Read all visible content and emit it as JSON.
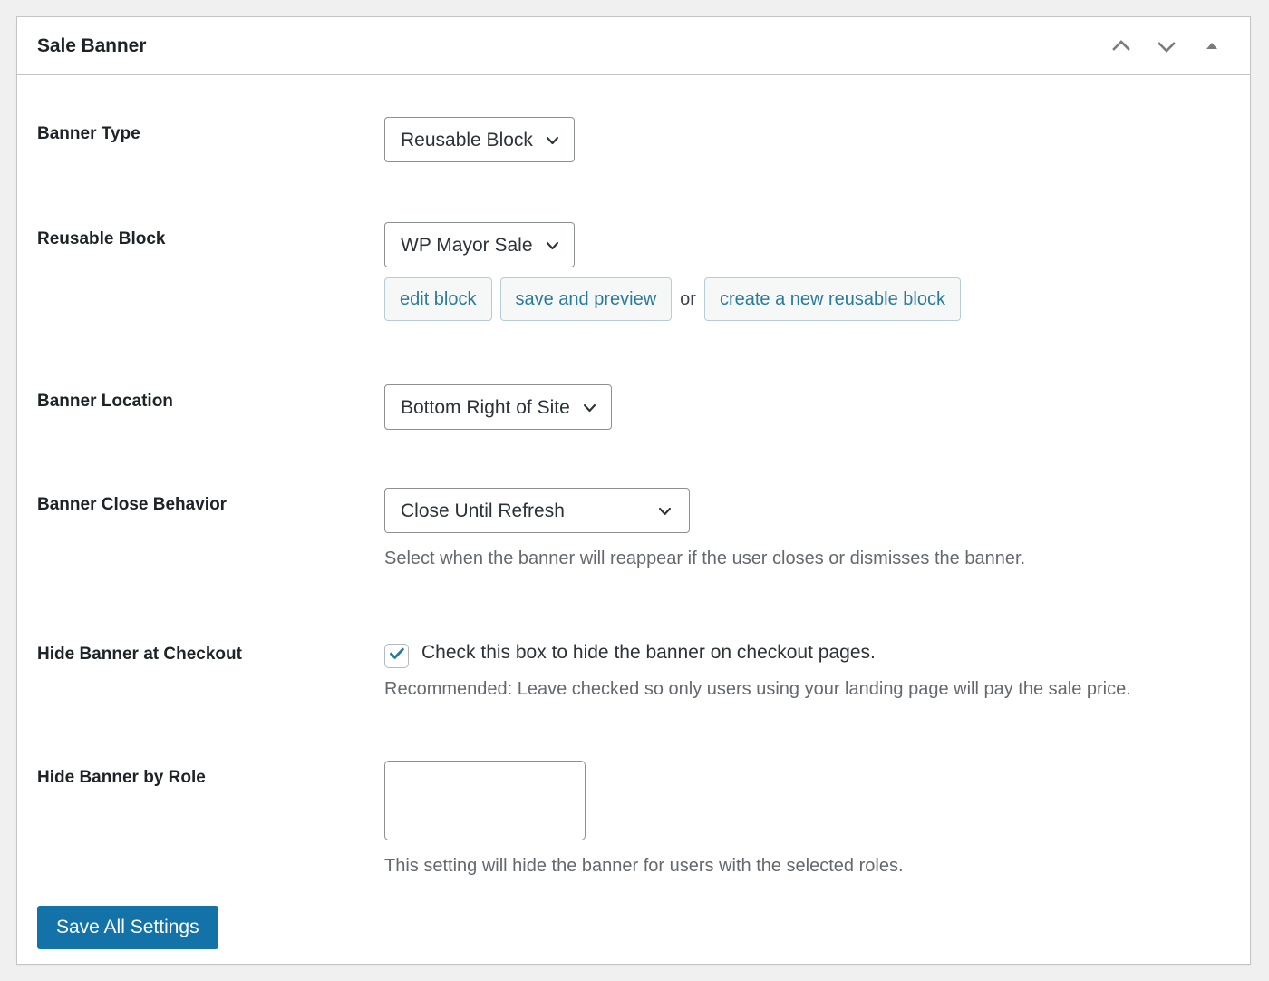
{
  "panel": {
    "title": "Sale Banner",
    "actions": [
      {
        "name": "move-up-icon",
        "label": "Move up"
      },
      {
        "name": "move-down-icon",
        "label": "Move down"
      },
      {
        "name": "toggle-panel-icon",
        "label": "Toggle panel"
      }
    ]
  },
  "colors": {
    "accent_blue": "#1373a8",
    "link_teal": "#2a7b9b",
    "checkbox_check": "#2a7b9b",
    "label_text": "#1d2327",
    "help_text": "#646970",
    "panel_border": "#c3c4c7",
    "page_background": "#f0f0f1"
  },
  "fields": {
    "banner_type": {
      "label": "Banner Type",
      "value": "Reusable Block"
    },
    "reusable_block": {
      "label": "Reusable Block",
      "value": "WP Mayor Sale",
      "buttons": {
        "edit": "edit block",
        "save_preview": "save and preview",
        "or": "or",
        "create": "create a new reusable block"
      }
    },
    "banner_location": {
      "label": "Banner Location",
      "value": "Bottom Right of Site"
    },
    "banner_close_behavior": {
      "label": "Banner Close Behavior",
      "value": "Close Until Refresh",
      "help": "Select when the banner will reappear if the user closes or dismisses the banner."
    },
    "hide_at_checkout": {
      "label": "Hide Banner at Checkout",
      "checkbox_label": "Check this box to hide the banner on checkout pages.",
      "checked": true,
      "help": "Recommended: Leave checked so only users using your landing page will pay the sale price."
    },
    "hide_by_role": {
      "label": "Hide Banner by Role",
      "value": "",
      "help": "This setting will hide the banner for users with the selected roles."
    }
  },
  "footer": {
    "save_label": "Save All Settings"
  }
}
